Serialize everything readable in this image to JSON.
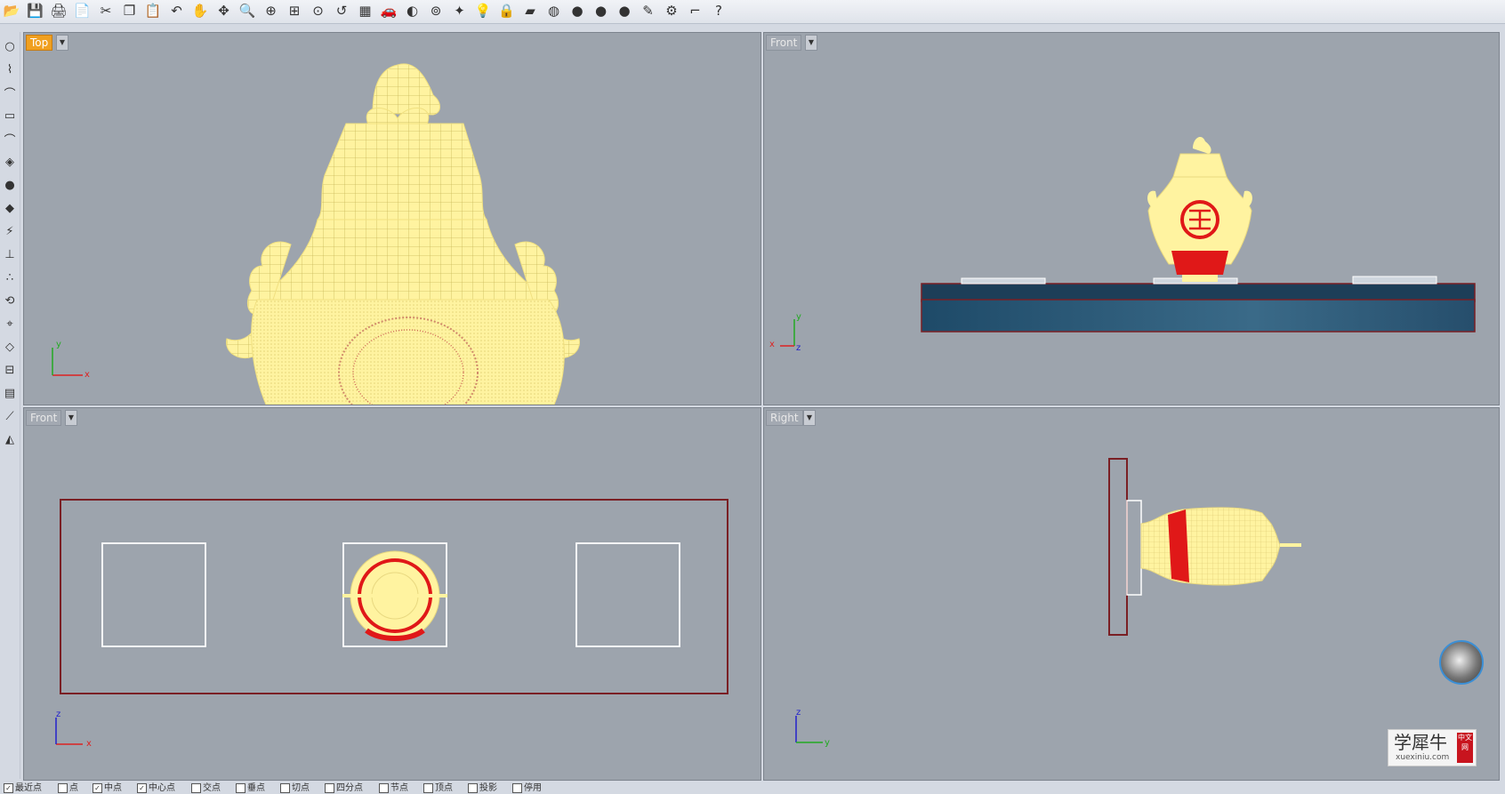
{
  "toolbar": {
    "icons": [
      "open-icon",
      "save-icon",
      "print-icon",
      "import-icon",
      "cut-icon",
      "copy-icon",
      "paste-icon",
      "undo-icon",
      "pan-icon",
      "rotate-view-icon",
      "zoom-icon",
      "zoom-window-icon",
      "zoom-extents-icon",
      "zoom-selected-icon",
      "undo-view-icon",
      "four-viewports-icon",
      "car-icon",
      "shaded-icon",
      "target-icon",
      "sparkle-icon",
      "lightbulb-icon",
      "lock-icon",
      "layer-icon",
      "color-wheel-icon",
      "sphere-gray-icon",
      "sphere-metal-icon",
      "sphere-blue-icon",
      "render-icon",
      "settings-icon",
      "dimension-icon",
      "help-icon"
    ],
    "glyphs": [
      "📂",
      "💾",
      "🖨",
      "📄",
      "✂",
      "❐",
      "📋",
      "↶",
      "✋",
      "✥",
      "🔍",
      "⊕",
      "⊞",
      "⊙",
      "↺",
      "▦",
      "🚗",
      "◐",
      "⊚",
      "✦",
      "💡",
      "🔒",
      "▰",
      "◍",
      "●",
      "●",
      "●",
      "✎",
      "⚙",
      "⌐",
      "?"
    ]
  },
  "lefttools": [
    "○",
    "⌇",
    "⌒",
    "▭",
    "⌒",
    "◈",
    "●",
    "◆",
    "⚡",
    "⊥",
    "∴",
    "⟲",
    "⌖",
    "◇",
    "⊟",
    "▤",
    "⟋",
    "◭"
  ],
  "viewports": {
    "top_left": {
      "label": "Top",
      "x_axis": "x",
      "y_axis": "y"
    },
    "top_right": {
      "label": "Front",
      "x_axis": "x",
      "y_axis": "y",
      "z_axis": "z"
    },
    "bottom_left": {
      "label": "Front",
      "x_axis": "x",
      "z_axis": "z"
    },
    "bottom_right": {
      "label": "Right",
      "z_axis": "z",
      "y_axis": "y"
    }
  },
  "statusbar": {
    "osnaps": [
      {
        "label": "最近点",
        "checked": true
      },
      {
        "label": "点",
        "checked": false
      },
      {
        "label": "中点",
        "checked": true
      },
      {
        "label": "中心点",
        "checked": true
      },
      {
        "label": "交点",
        "checked": false
      },
      {
        "label": "垂点",
        "checked": false
      },
      {
        "label": "切点",
        "checked": false
      },
      {
        "label": "四分点",
        "checked": false
      },
      {
        "label": "节点",
        "checked": false
      },
      {
        "label": "顶点",
        "checked": false
      },
      {
        "label": "投影",
        "checked": false
      },
      {
        "label": "停用",
        "checked": false
      }
    ]
  },
  "watermark": {
    "main": "学犀牛",
    "sub": "xuexiniu.com",
    "tag": "中文网"
  },
  "colors": {
    "wire": "#ffee90",
    "highlight": "#e02020",
    "viewport_bg": "#9da4ad",
    "active_label": "#f0a020",
    "frame": "#7a1f24",
    "slab": "#2a5876"
  }
}
